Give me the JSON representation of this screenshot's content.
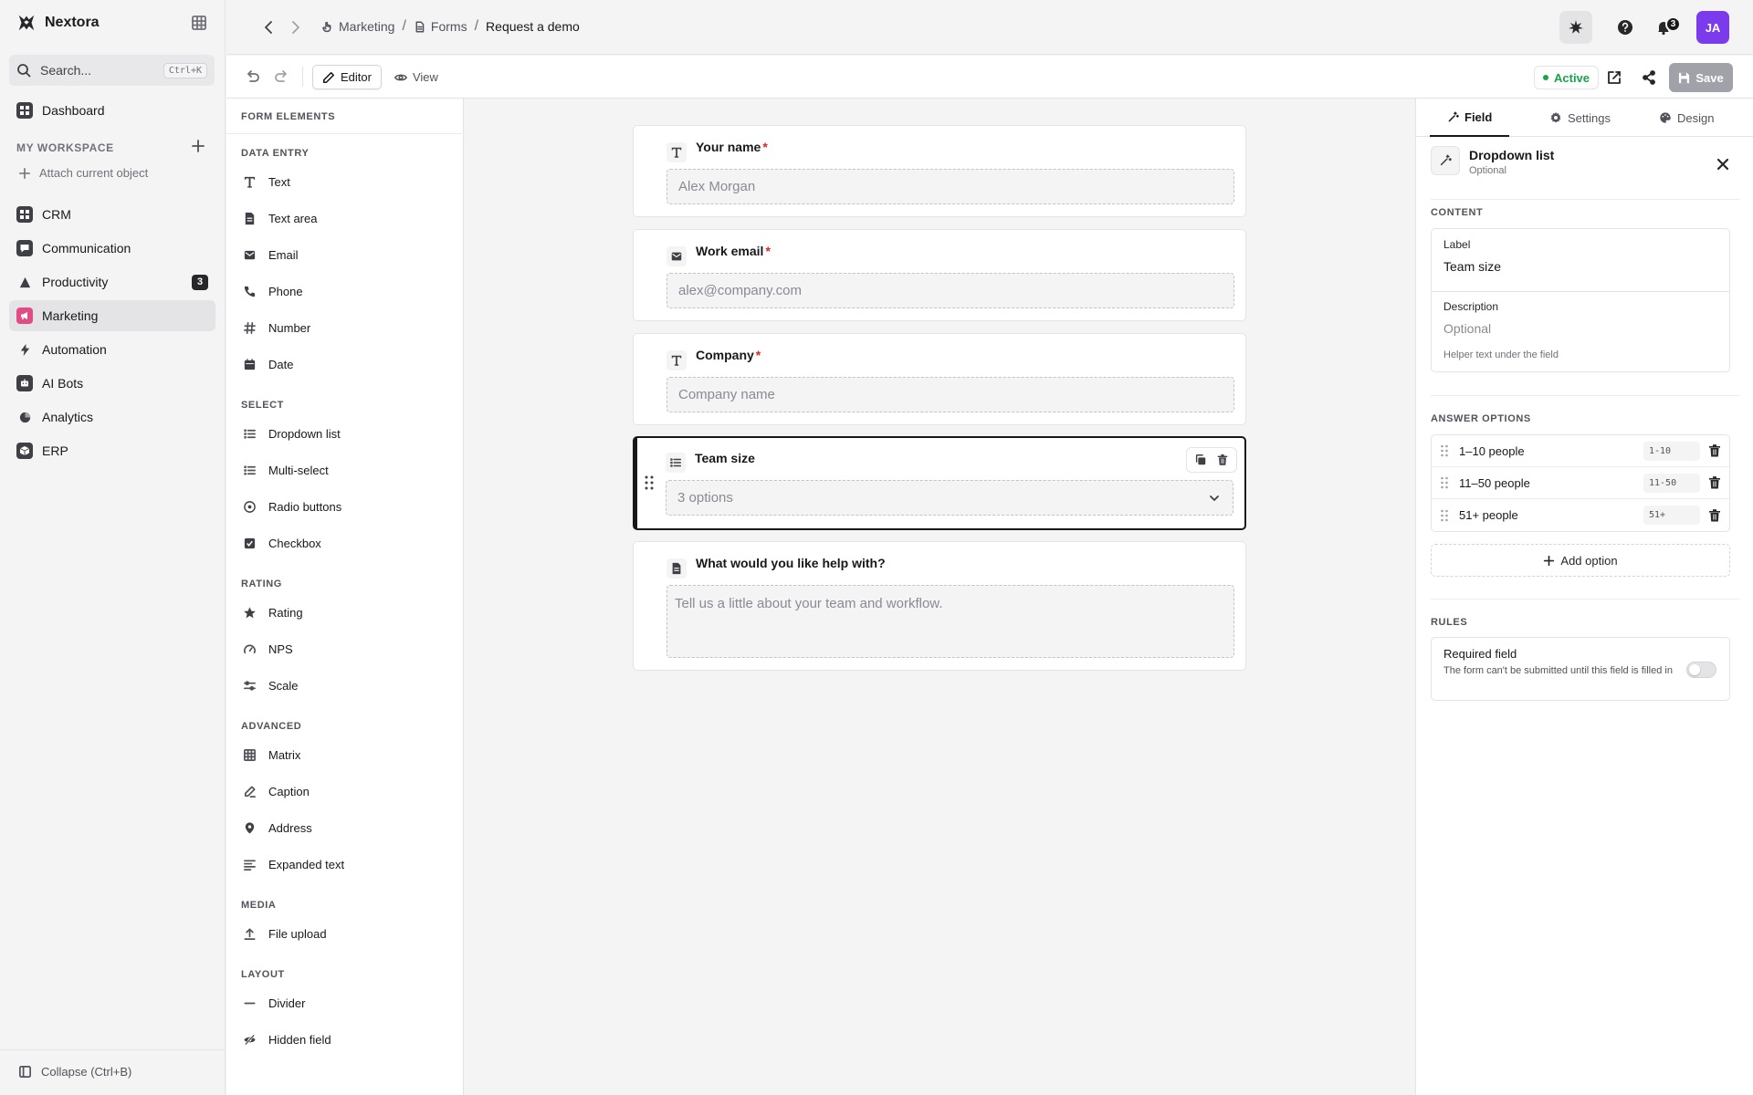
{
  "app": {
    "name": "Nextora"
  },
  "search": {
    "placeholder": "Search...",
    "shortcut": "Ctrl+K"
  },
  "sidebar": {
    "dashboard": "Dashboard",
    "workspace_label": "MY WORKSPACE",
    "attach": "Attach current object",
    "items": [
      {
        "label": "CRM"
      },
      {
        "label": "Communication"
      },
      {
        "label": "Productivity",
        "badge": "3"
      },
      {
        "label": "Marketing"
      },
      {
        "label": "Automation"
      },
      {
        "label": "AI Bots"
      },
      {
        "label": "Analytics"
      },
      {
        "label": "ERP"
      }
    ],
    "collapse": "Collapse (Ctrl+B)"
  },
  "breadcrumb": {
    "parent": "Marketing",
    "section": "Forms",
    "current": "Request a demo"
  },
  "topbar": {
    "notifications": "3",
    "avatar": "JA"
  },
  "toolbar": {
    "editor": "Editor",
    "view": "View",
    "status": "Active",
    "save": "Save",
    "status_color": "#16a34a"
  },
  "elements": {
    "title": "FORM ELEMENTS",
    "groups": [
      {
        "title": "DATA ENTRY",
        "items": [
          "Text",
          "Text area",
          "Email",
          "Phone",
          "Number",
          "Date"
        ]
      },
      {
        "title": "SELECT",
        "items": [
          "Dropdown list",
          "Multi-select",
          "Radio buttons",
          "Checkbox"
        ]
      },
      {
        "title": "RATING",
        "items": [
          "Rating",
          "NPS",
          "Scale"
        ]
      },
      {
        "title": "ADVANCED",
        "items": [
          "Matrix",
          "Caption",
          "Address",
          "Expanded text"
        ]
      },
      {
        "title": "MEDIA",
        "items": [
          "File upload"
        ]
      },
      {
        "title": "LAYOUT",
        "items": [
          "Divider",
          "Hidden field"
        ]
      }
    ]
  },
  "form": {
    "fields": [
      {
        "label": "Your name",
        "required": "*",
        "placeholder": "Alex Morgan"
      },
      {
        "label": "Work email",
        "required": "*",
        "placeholder": "alex@company.com"
      },
      {
        "label": "Company",
        "required": "*",
        "placeholder": "Company name"
      },
      {
        "label": "Team size",
        "placeholder": "3 options"
      },
      {
        "label": "What would you like help with?",
        "placeholder": "Tell us a little about your team and workflow."
      }
    ]
  },
  "props": {
    "tabs": [
      "Field",
      "Settings",
      "Design"
    ],
    "field_type": "Dropdown list",
    "field_type_sub": "Optional",
    "content_title": "CONTENT",
    "label_caption": "Label",
    "label_value": "Team size",
    "desc_caption": "Description",
    "desc_placeholder": "Optional",
    "desc_help": "Helper text under the field",
    "options_title": "ANSWER OPTIONS",
    "options": [
      {
        "label": "1–10 people",
        "value": "1-10"
      },
      {
        "label": "11–50 people",
        "value": "11-50"
      },
      {
        "label": "51+ people",
        "value": "51+"
      }
    ],
    "add_option": "Add option",
    "rules_title": "RULES",
    "rule_title": "Required field",
    "rule_desc": "The form can't be submitted until this field is filled in"
  }
}
